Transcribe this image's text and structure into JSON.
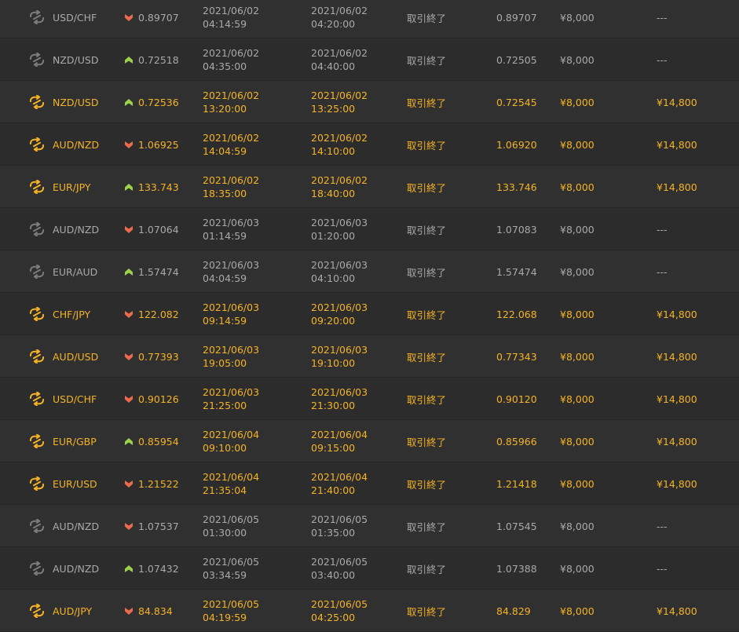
{
  "rows": [
    {
      "pair": "USD/CHF",
      "direction": "down",
      "entry_price": "0.89707",
      "open_date": "2021/06/02",
      "open_time": "04:14:59",
      "close_date": "2021/06/02",
      "close_time": "04:20:00",
      "status": "取引終了",
      "exit_price": "0.89707",
      "amount": "¥8,000",
      "payout": "---",
      "result": "loss"
    },
    {
      "pair": "NZD/USD",
      "direction": "up",
      "entry_price": "0.72518",
      "open_date": "2021/06/02",
      "open_time": "04:35:00",
      "close_date": "2021/06/02",
      "close_time": "04:40:00",
      "status": "取引終了",
      "exit_price": "0.72505",
      "amount": "¥8,000",
      "payout": "---",
      "result": "loss"
    },
    {
      "pair": "NZD/USD",
      "direction": "up",
      "entry_price": "0.72536",
      "open_date": "2021/06/02",
      "open_time": "13:20:00",
      "close_date": "2021/06/02",
      "close_time": "13:25:00",
      "status": "取引終了",
      "exit_price": "0.72545",
      "amount": "¥8,000",
      "payout": "¥14,800",
      "result": "win"
    },
    {
      "pair": "AUD/NZD",
      "direction": "down",
      "entry_price": "1.06925",
      "open_date": "2021/06/02",
      "open_time": "14:04:59",
      "close_date": "2021/06/02",
      "close_time": "14:10:00",
      "status": "取引終了",
      "exit_price": "1.06920",
      "amount": "¥8,000",
      "payout": "¥14,800",
      "result": "win"
    },
    {
      "pair": "EUR/JPY",
      "direction": "up",
      "entry_price": "133.743",
      "open_date": "2021/06/02",
      "open_time": "18:35:00",
      "close_date": "2021/06/02",
      "close_time": "18:40:00",
      "status": "取引終了",
      "exit_price": "133.746",
      "amount": "¥8,000",
      "payout": "¥14,800",
      "result": "win"
    },
    {
      "pair": "AUD/NZD",
      "direction": "down",
      "entry_price": "1.07064",
      "open_date": "2021/06/03",
      "open_time": "01:14:59",
      "close_date": "2021/06/03",
      "close_time": "01:20:00",
      "status": "取引終了",
      "exit_price": "1.07083",
      "amount": "¥8,000",
      "payout": "---",
      "result": "loss"
    },
    {
      "pair": "EUR/AUD",
      "direction": "up",
      "entry_price": "1.57474",
      "open_date": "2021/06/03",
      "open_time": "04:04:59",
      "close_date": "2021/06/03",
      "close_time": "04:10:00",
      "status": "取引終了",
      "exit_price": "1.57474",
      "amount": "¥8,000",
      "payout": "---",
      "result": "loss"
    },
    {
      "pair": "CHF/JPY",
      "direction": "down",
      "entry_price": "122.082",
      "open_date": "2021/06/03",
      "open_time": "09:14:59",
      "close_date": "2021/06/03",
      "close_time": "09:20:00",
      "status": "取引終了",
      "exit_price": "122.068",
      "amount": "¥8,000",
      "payout": "¥14,800",
      "result": "win"
    },
    {
      "pair": "AUD/USD",
      "direction": "down",
      "entry_price": "0.77393",
      "open_date": "2021/06/03",
      "open_time": "19:05:00",
      "close_date": "2021/06/03",
      "close_time": "19:10:00",
      "status": "取引終了",
      "exit_price": "0.77343",
      "amount": "¥8,000",
      "payout": "¥14,800",
      "result": "win"
    },
    {
      "pair": "USD/CHF",
      "direction": "down",
      "entry_price": "0.90126",
      "open_date": "2021/06/03",
      "open_time": "21:25:00",
      "close_date": "2021/06/03",
      "close_time": "21:30:00",
      "status": "取引終了",
      "exit_price": "0.90120",
      "amount": "¥8,000",
      "payout": "¥14,800",
      "result": "win"
    },
    {
      "pair": "EUR/GBP",
      "direction": "up",
      "entry_price": "0.85954",
      "open_date": "2021/06/04",
      "open_time": "09:10:00",
      "close_date": "2021/06/04",
      "close_time": "09:15:00",
      "status": "取引終了",
      "exit_price": "0.85966",
      "amount": "¥8,000",
      "payout": "¥14,800",
      "result": "win"
    },
    {
      "pair": "EUR/USD",
      "direction": "down",
      "entry_price": "1.21522",
      "open_date": "2021/06/04",
      "open_time": "21:35:04",
      "close_date": "2021/06/04",
      "close_time": "21:40:00",
      "status": "取引終了",
      "exit_price": "1.21418",
      "amount": "¥8,000",
      "payout": "¥14,800",
      "result": "win"
    },
    {
      "pair": "AUD/NZD",
      "direction": "down",
      "entry_price": "1.07537",
      "open_date": "2021/06/05",
      "open_time": "01:30:00",
      "close_date": "2021/06/05",
      "close_time": "01:35:00",
      "status": "取引終了",
      "exit_price": "1.07545",
      "amount": "¥8,000",
      "payout": "---",
      "result": "loss"
    },
    {
      "pair": "AUD/NZD",
      "direction": "up",
      "entry_price": "1.07432",
      "open_date": "2021/06/05",
      "open_time": "03:34:59",
      "close_date": "2021/06/05",
      "close_time": "03:40:00",
      "status": "取引終了",
      "exit_price": "1.07388",
      "amount": "¥8,000",
      "payout": "---",
      "result": "loss"
    },
    {
      "pair": "AUD/JPY",
      "direction": "down",
      "entry_price": "84.834",
      "open_date": "2021/06/05",
      "open_time": "04:19:59",
      "close_date": "2021/06/05",
      "close_time": "04:25:00",
      "status": "取引終了",
      "exit_price": "84.829",
      "amount": "¥8,000",
      "payout": "¥14,800",
      "result": "win"
    }
  ],
  "colors": {
    "win_text": "#f5b324",
    "loss_text": "#a9a9a9",
    "loss_icon": "#7c7c7c",
    "arrow_up": "#9bd24a",
    "arrow_down": "#ee6a4c",
    "background": "#2e2e2e"
  },
  "icons": {
    "pair": "currency-exchange-icon",
    "up": "arrow-up-icon",
    "down": "arrow-down-icon"
  }
}
